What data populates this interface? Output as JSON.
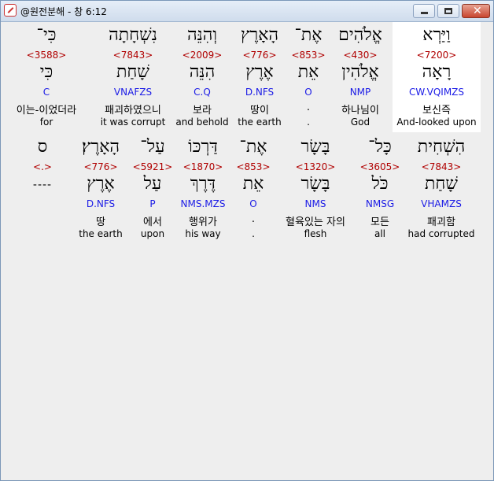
{
  "window": {
    "title": "@원전분해 - 창 6:12"
  },
  "rows": [
    [
      {
        "heb": "וַיַּרְא",
        "strong": "<7200>",
        "heb2": "רָאָה",
        "morph": "CW.VQIMZS",
        "kor": "보신즉",
        "eng": "And-looked upon",
        "highlight": true
      },
      {
        "heb": "אֱלֹהִים",
        "strong": "<430>",
        "heb2": "אֱלֹהִין",
        "morph": "NMP",
        "kor": "하나님이",
        "eng": "God"
      },
      {
        "heb": "אֶת־",
        "strong": "<853>",
        "heb2": "אֵת",
        "morph": "O",
        "kor": ".",
        "eng": "."
      },
      {
        "heb": "הָאָרֶץ",
        "strong": "<776>",
        "heb2": "אֶרֶץ",
        "morph": "D.NFS",
        "kor": "땅이",
        "eng": "the earth"
      },
      {
        "heb": "וְהִנֵּה",
        "strong": "<2009>",
        "heb2": "הִנֵּה",
        "morph": "C.Q",
        "kor": "보라",
        "eng": "and behold"
      },
      {
        "heb": "נִשְׁחָתָה",
        "strong": "<7843>",
        "heb2": "שָׁחַת",
        "morph": "VNAFZS",
        "kor": "패괴하였으니",
        "eng": "it was corrupt"
      },
      {
        "heb": "כִּי־",
        "strong": "<3588>",
        "heb2": "כִּי",
        "morph": "C",
        "kor": "이는-이었더라",
        "eng": "for"
      }
    ],
    [
      {
        "heb": "הִשְׁחִית",
        "strong": "<7843>",
        "heb2": "שָׁחַת",
        "morph": "VHAMZS",
        "kor": "패괴함",
        "eng": "had corrupted"
      },
      {
        "heb": "כָּל־",
        "strong": "<3605>",
        "heb2": "כֹּל",
        "morph": "NMSG",
        "kor": "모든",
        "eng": "all"
      },
      {
        "heb": "בָּשָׂר",
        "strong": "<1320>",
        "heb2": "בָּשָׂר",
        "morph": "NMS",
        "kor": "혈육있는 자의",
        "eng": "flesh"
      },
      {
        "heb": "אֶת־",
        "strong": "<853>",
        "heb2": "אֵת",
        "morph": "O",
        "kor": ".",
        "eng": "."
      },
      {
        "heb": "דַּרְכּוֹ",
        "strong": "<1870>",
        "heb2": "דֶּרֶךְ",
        "morph": "NMS.MZS",
        "kor": "행위가",
        "eng": "his way"
      },
      {
        "heb": "עַל־",
        "strong": "<5921>",
        "heb2": "עַל",
        "morph": "P",
        "kor": "에서",
        "eng": "upon"
      },
      {
        "heb": "הָאָרֶץ׃",
        "strong": "<776>",
        "heb2": "אֶרֶץ",
        "morph": "D.NFS",
        "kor": "땅",
        "eng": "the earth"
      },
      {
        "heb": "ס",
        "strong": "<.>",
        "dash": "----",
        "morph": "",
        "kor": "",
        "eng": ""
      }
    ]
  ]
}
